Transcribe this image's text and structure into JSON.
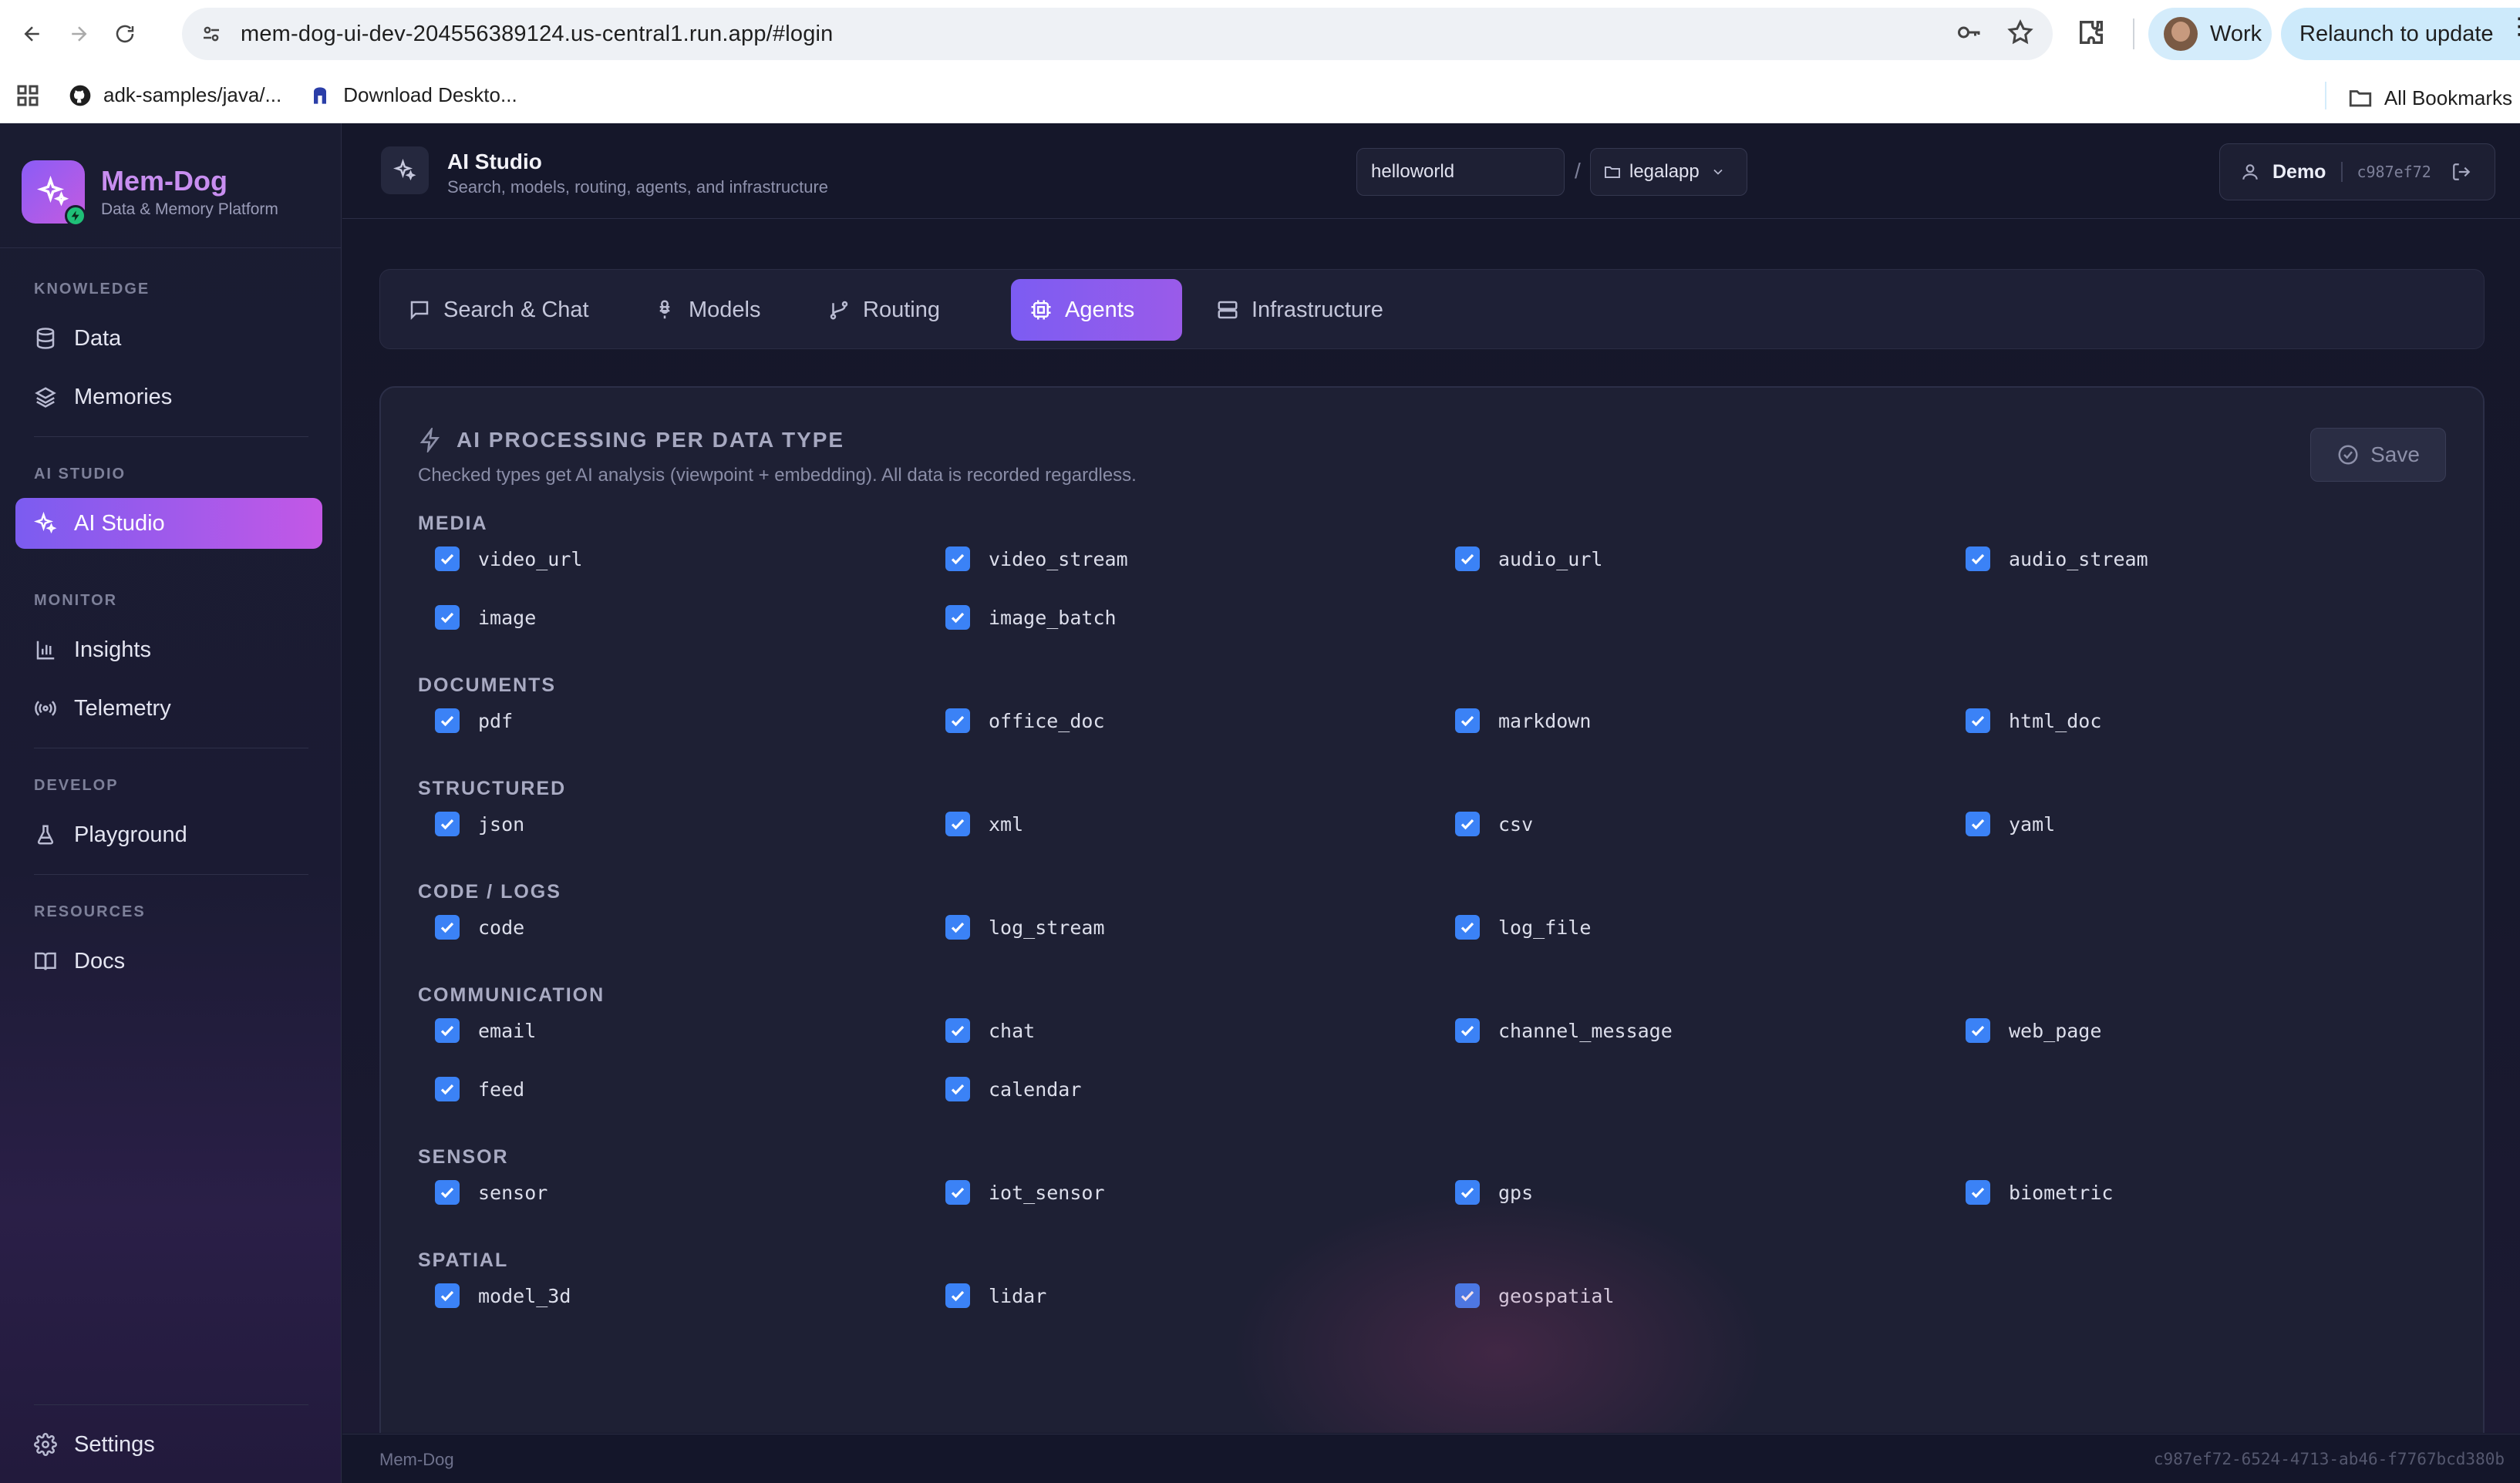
{
  "browser": {
    "url": "mem-dog-ui-dev-204556389124.us-central1.run.app/#login",
    "profile": "Work",
    "relaunch": "Relaunch to update",
    "bookmarks": [
      "adk-samples/java/...",
      "Download Deskto..."
    ],
    "all_bookmarks": "All Bookmarks"
  },
  "brand": {
    "name": "Mem-Dog",
    "tagline": "Data & Memory Platform"
  },
  "sidebar": {
    "sections": [
      {
        "label": "KNOWLEDGE"
      },
      {
        "label": "AI STUDIO"
      },
      {
        "label": "MONITOR"
      },
      {
        "label": "DEVELOP"
      },
      {
        "label": "RESOURCES"
      }
    ],
    "items": [
      {
        "label": "Data",
        "icon": "database-icon"
      },
      {
        "label": "Memories",
        "icon": "layers-icon"
      },
      {
        "label": "AI Studio",
        "icon": "sparkles-icon",
        "active": true
      },
      {
        "label": "Insights",
        "icon": "bar-chart-icon"
      },
      {
        "label": "Telemetry",
        "icon": "radio-icon"
      },
      {
        "label": "Playground",
        "icon": "flask-icon"
      },
      {
        "label": "Docs",
        "icon": "book-icon"
      }
    ],
    "settings": "Settings"
  },
  "header": {
    "title": "AI Studio",
    "subtitle": "Search, models, routing, agents, and infrastructure",
    "namespace": "helloworld",
    "separator": "/",
    "app": "legalapp",
    "user": "Demo",
    "user_id": "c987ef72"
  },
  "tabs": [
    {
      "label": "Search & Chat",
      "icon": "message-icon"
    },
    {
      "label": "Models",
      "icon": "chip-icon"
    },
    {
      "label": "Routing",
      "icon": "git-branch-icon"
    },
    {
      "label": "Agents",
      "icon": "cpu-icon",
      "active": true
    },
    {
      "label": "Infrastructure",
      "icon": "server-icon"
    }
  ],
  "panel": {
    "title": "AI PROCESSING PER DATA TYPE",
    "description": "Checked types get AI analysis (viewpoint + embedding). All data is recorded regardless.",
    "save_label": "Save",
    "groups": [
      {
        "label": "MEDIA",
        "items": [
          "video_url",
          "video_stream",
          "audio_url",
          "audio_stream",
          "image",
          "image_batch"
        ]
      },
      {
        "label": "DOCUMENTS",
        "items": [
          "pdf",
          "office_doc",
          "markdown",
          "html_doc"
        ]
      },
      {
        "label": "STRUCTURED",
        "items": [
          "json",
          "xml",
          "csv",
          "yaml"
        ]
      },
      {
        "label": "CODE / LOGS",
        "items": [
          "code",
          "log_stream",
          "log_file"
        ]
      },
      {
        "label": "COMMUNICATION",
        "items": [
          "email",
          "chat",
          "channel_message",
          "web_page",
          "feed",
          "calendar"
        ]
      },
      {
        "label": "SENSOR",
        "items": [
          "sensor",
          "iot_sensor",
          "gps",
          "biometric"
        ]
      },
      {
        "label": "SPATIAL",
        "items": [
          "model_3d",
          "lidar",
          "geospatial"
        ]
      }
    ]
  },
  "footer": {
    "left": "Mem-Dog",
    "right": "c987ef72-6524-4713-ab46-f7767bcd380b"
  },
  "colors": {
    "accent": "#7c5cf2",
    "brand_pink": "#c358e6",
    "checkbox": "#3b82f6"
  }
}
